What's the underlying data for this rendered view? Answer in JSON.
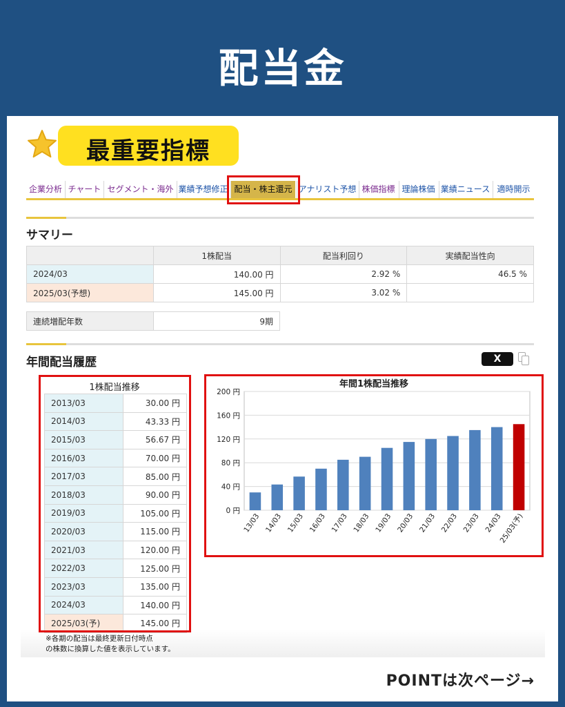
{
  "title": "配当金",
  "badge": "最重要指標",
  "tabs": [
    {
      "label": "企業分析",
      "color": "purple"
    },
    {
      "label": "チャート",
      "color": "purple"
    },
    {
      "label": "セグメント・海外",
      "color": "purple"
    },
    {
      "label": "業績予想修正",
      "color": "blue"
    },
    {
      "label": "配当・株主還元",
      "color": "active"
    },
    {
      "label": "アナリスト予想",
      "color": "blue"
    },
    {
      "label": "株価指標",
      "color": "purple"
    },
    {
      "label": "理論株価",
      "color": "blue"
    },
    {
      "label": "業績ニュース",
      "color": "blue"
    },
    {
      "label": "適時開示",
      "color": "blue"
    }
  ],
  "summary": {
    "title": "サマリー",
    "headers": [
      "",
      "1株配当",
      "配当利回り",
      "実績配当性向"
    ],
    "rows": [
      [
        "2024/03",
        "140.00 円",
        "2.92 %",
        "46.5 %"
      ],
      [
        "2025/03(予想)",
        "145.00 円",
        "3.02 %",
        ""
      ]
    ],
    "streak_label": "連続増配年数",
    "streak_value": "9期"
  },
  "history": {
    "title": "年間配当履歴",
    "x_button": "X",
    "table_title": "1株配当推移",
    "rows": [
      [
        "2013/03",
        "30.00 円"
      ],
      [
        "2014/03",
        "43.33 円"
      ],
      [
        "2015/03",
        "56.67 円"
      ],
      [
        "2016/03",
        "70.00 円"
      ],
      [
        "2017/03",
        "85.00 円"
      ],
      [
        "2018/03",
        "90.00 円"
      ],
      [
        "2019/03",
        "105.00 円"
      ],
      [
        "2020/03",
        "115.00 円"
      ],
      [
        "2021/03",
        "120.00 円"
      ],
      [
        "2022/03",
        "125.00 円"
      ],
      [
        "2023/03",
        "135.00 円"
      ],
      [
        "2024/03",
        "140.00 円"
      ],
      [
        "2025/03(予)",
        "145.00 円"
      ]
    ],
    "note_line1": "※各期の配当は最終更新日付時点",
    "note_line2": "の株数に換算した値を表示しています。"
  },
  "chart_data": {
    "type": "bar",
    "title": "年間1株配当推移",
    "categories": [
      "13/03",
      "14/03",
      "15/03",
      "16/03",
      "17/03",
      "18/03",
      "19/03",
      "20/03",
      "21/03",
      "22/03",
      "23/03",
      "24/03",
      "25/03(予)"
    ],
    "values": [
      30.0,
      43.33,
      56.67,
      70.0,
      85.0,
      90.0,
      105.0,
      115.0,
      120.0,
      125.0,
      135.0,
      140.0,
      145.0
    ],
    "ylim": [
      0,
      200
    ],
    "yticks": [
      "0 円",
      "40 円",
      "80 円",
      "120 円",
      "160 円",
      "200 円"
    ],
    "grid": true,
    "bar_color": "#4f81bd",
    "forecast_color": "#c00000"
  },
  "footer": "POINTは次ページ→"
}
